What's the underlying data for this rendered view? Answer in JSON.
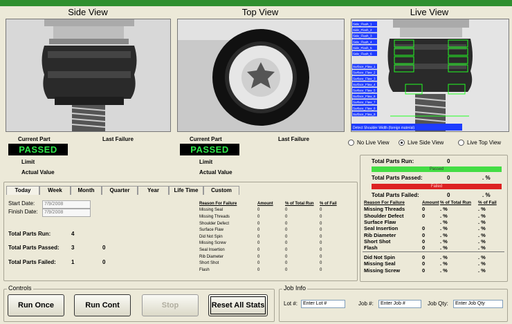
{
  "views": {
    "side": "Side View",
    "top": "Top View",
    "live": "Live View"
  },
  "side_panel": {
    "current_part": "Current Part",
    "last_failure": "Last Failure",
    "status": "PASSED",
    "limit": "Limit",
    "actual": "Actual Value"
  },
  "top_panel": {
    "current_part": "Current Part",
    "last_failure": "Last Failure",
    "status": "PASSED",
    "limit": "Limit",
    "actual": "Actual Value"
  },
  "live_overlay_labels": [
    "Side_Flash_1",
    "Side_Flash_2",
    "Side_Flash_3",
    "Side_Flash_4",
    "Side_Flash_5",
    "Side_Flash_6",
    "Surface_Flaw_1",
    "Surface_Flaw_2",
    "Surface_Flaw_3",
    "Surface_Flaw_4",
    "Surface_Flaw_5",
    "Surface_Flaw_6",
    "Surface_Flaw_7",
    "Surface_Flaw_8",
    "Surface_Flaw_9"
  ],
  "live_overlay_caption": "Detect Shoulder Width (foreign material)",
  "live_options": [
    {
      "label": "No Live View",
      "selected": false
    },
    {
      "label": "Live Side View",
      "selected": true
    },
    {
      "label": "Live Top View",
      "selected": false
    }
  ],
  "tabs": [
    "Today",
    "Week",
    "Month",
    "Quarter",
    "Year",
    "Life Time",
    "Custom"
  ],
  "stats": {
    "start_date_label": "Start Date:",
    "start_date": "7/9/2008",
    "finish_date_label": "Finish Date:",
    "finish_date": "7/9/2008",
    "total_run_label": "Total Parts Run:",
    "total_run": "4",
    "total_passed_label": "Total Parts Passed:",
    "total_passed": "3",
    "passed_pct": "0",
    "total_failed_label": "Total Parts Failed:",
    "total_failed": "1",
    "failed_pct": "0"
  },
  "failure_table": {
    "headers": [
      "Reason For Failure",
      "Amount",
      "% of Total Run",
      "% of Fail"
    ],
    "rows": [
      [
        "Missing Seal",
        "0",
        "0",
        "0"
      ],
      [
        "Missing Threads",
        "0",
        "0",
        "0"
      ],
      [
        "Shoulder Defect",
        "0",
        "0",
        "0"
      ],
      [
        "Surface Flaw",
        "0",
        "0",
        "0"
      ],
      [
        "Did Not Spin",
        "0",
        "0",
        "0"
      ],
      [
        "Missing Screw",
        "0",
        "0",
        "0"
      ],
      [
        "Seal Insertion",
        "0",
        "0",
        "0"
      ],
      [
        "Rib Diameter",
        "0",
        "0",
        "0"
      ],
      [
        "Short Shot",
        "0",
        "0",
        "0"
      ],
      [
        "Flash",
        "0",
        "0",
        "0"
      ]
    ]
  },
  "right_panel": {
    "total_run_label": "Total Parts Run:",
    "total_run": "0",
    "passed_bar": "Passed",
    "failed_bar": "Failed",
    "passed_label": "Total Parts Passed:",
    "passed_value": "0",
    "passed_unit": ". %",
    "failed_label": "Total Parts Failed:",
    "failed_value": "0",
    "failed_unit": ". %",
    "headers": [
      "Reason For Failure",
      "Amount",
      "% of Total Run",
      "% of Fail"
    ],
    "rows": [
      [
        "Missing Threads",
        "0",
        ". %",
        ". %"
      ],
      [
        "Shoulder Defect",
        "0",
        ". %",
        ". %"
      ],
      [
        "Surface Flaw",
        "",
        ". %",
        ". %"
      ],
      [
        "Seal Insertion",
        "0",
        ". %",
        ". %"
      ],
      [
        "Rib Diameter",
        "0",
        ". %",
        ". %"
      ],
      [
        "Short Shot",
        "0",
        ". %",
        ". %"
      ],
      [
        "Flash",
        "0",
        ". %",
        ". %"
      ]
    ],
    "rows2": [
      [
        "Did Not Spin",
        "0",
        ". %",
        ". %"
      ],
      [
        "Missing Seal",
        "0",
        ". %",
        ". %"
      ],
      [
        "Missing Screw",
        "0",
        ". %",
        ". %"
      ]
    ]
  },
  "controls": {
    "title": "Controls",
    "run_once": "Run Once",
    "run_cont": "Run Cont",
    "stop": "Stop",
    "reset": "Reset All Stats"
  },
  "job_info": {
    "title": "Job Info",
    "lot_label": "Lot #:",
    "lot_value": "Enter Lot #",
    "job_label": "Job #:",
    "job_value": "Enter Job #",
    "qty_label": "Job Qty:",
    "qty_value": "Enter Job Qty"
  },
  "colors": {
    "passed_green": "#2ee84a",
    "bar_green": "#44dd44",
    "bar_red": "#dd2222",
    "overlay_blue": "#1e3cff",
    "overlay_green": "#22ff22"
  }
}
